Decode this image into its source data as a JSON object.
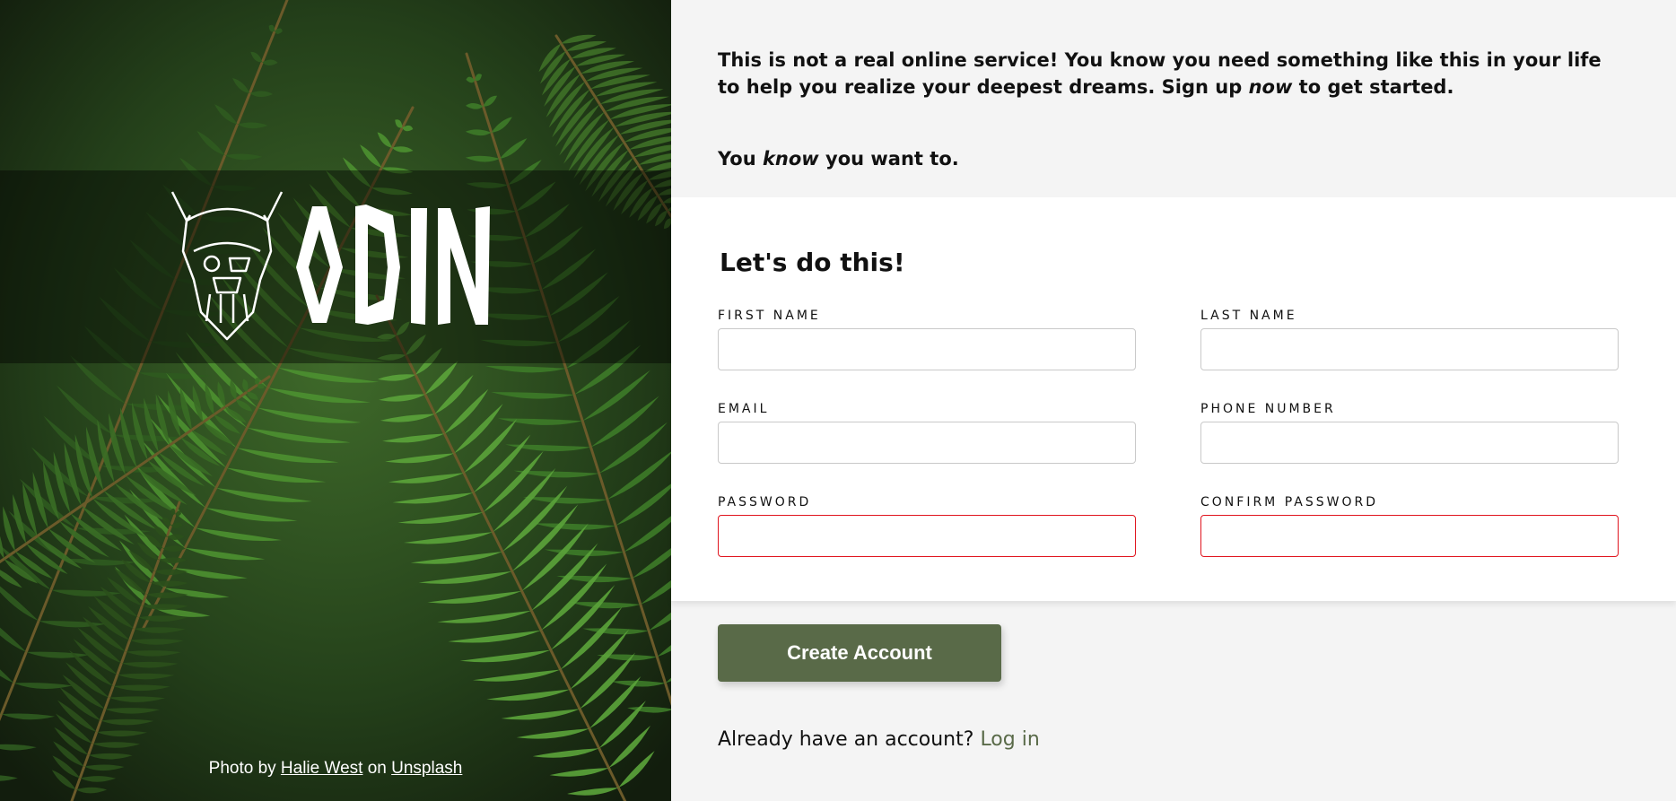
{
  "hero": {
    "logo_text": "ODIN",
    "credit": {
      "prefix": "Photo by ",
      "author": "Halie West",
      "middle": " on ",
      "site": "Unsplash"
    }
  },
  "intro": {
    "line1_a": "This is not a real online service! You know you need something like this in your life to help you realize your deepest dreams. Sign up ",
    "line1_em": "now",
    "line1_b": " to get started.",
    "line2_a": "You ",
    "line2_em": "know",
    "line2_b": " you want to."
  },
  "form": {
    "title": "Let's do this!",
    "fields": {
      "first_name": {
        "label": "FIRST NAME",
        "value": ""
      },
      "last_name": {
        "label": "LAST NAME",
        "value": ""
      },
      "email": {
        "label": "EMAIL",
        "value": ""
      },
      "phone": {
        "label": "PHONE NUMBER",
        "value": ""
      },
      "password": {
        "label": "PASSWORD",
        "value": ""
      },
      "confirm_password": {
        "label": "CONFIRM PASSWORD",
        "value": ""
      }
    },
    "submit_label": "Create Account",
    "login_prompt": "Already have an account? ",
    "login_link": "Log in"
  },
  "colors": {
    "accent": "#596a48",
    "invalid_border": "#e0141e",
    "panel_bg": "#f4f4f4"
  }
}
